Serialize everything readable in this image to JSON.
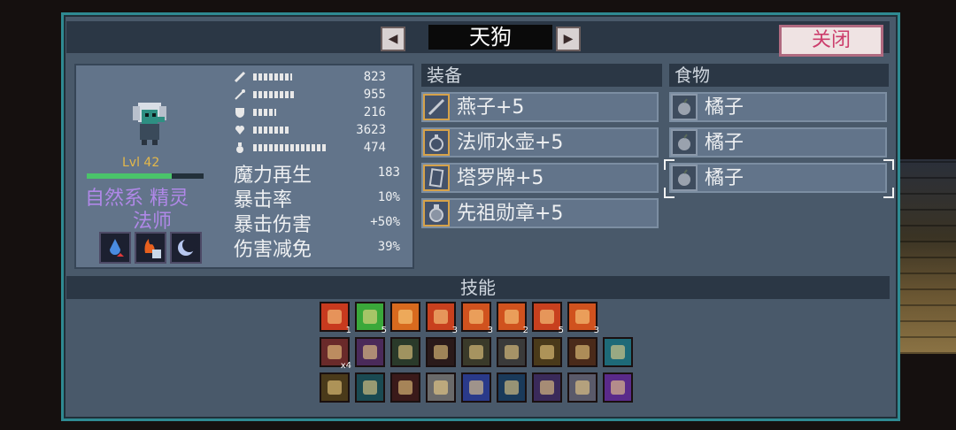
{
  "header": {
    "title": "天狗",
    "close_label": "关闭",
    "prev_icon": "triangle-left",
    "next_icon": "triangle-right"
  },
  "character": {
    "level": "Lvl 42",
    "class_line1": "自然系 精灵",
    "class_line2": "法师",
    "hp_fraction": 0.73,
    "stats": [
      {
        "icon": "sword-icon",
        "value": "823"
      },
      {
        "icon": "wand-icon",
        "value": "955"
      },
      {
        "icon": "shield-icon",
        "value": "216"
      },
      {
        "icon": "heart-icon",
        "value": "3623"
      },
      {
        "icon": "potion-icon",
        "value": "474"
      }
    ],
    "extra_stats": [
      {
        "label": "魔力再生",
        "value": "183"
      },
      {
        "label": "暴击率",
        "value": "10%"
      },
      {
        "label": "暴击伤害",
        "value": "+50%"
      },
      {
        "label": "伤害减免",
        "value": "39%"
      }
    ],
    "traits": [
      "water-drop-icon",
      "fire-shield-icon",
      "moon-icon"
    ]
  },
  "equipment": {
    "header": "装备",
    "items": [
      {
        "label": "燕子+5",
        "icon": "staff-icon"
      },
      {
        "label": "法师水壶+5",
        "icon": "flask-icon"
      },
      {
        "label": "塔罗牌+5",
        "icon": "card-icon"
      },
      {
        "label": "先祖勋章+5",
        "icon": "medal-icon"
      }
    ]
  },
  "food": {
    "header": "食物",
    "items": [
      {
        "label": "橘子",
        "icon": "orange-icon"
      },
      {
        "label": "橘子",
        "icon": "orange-icon"
      },
      {
        "label": "橘子",
        "icon": "orange-icon"
      }
    ]
  },
  "skills": {
    "header": "技能",
    "row1": [
      {
        "icon": "fire-burst-icon",
        "count": "1",
        "color": "#c83a1e"
      },
      {
        "icon": "green-burst-icon",
        "count": "5",
        "color": "#3aa83a"
      },
      {
        "icon": "flame-pillar-icon",
        "count": "",
        "color": "#d86a1e"
      },
      {
        "icon": "fire-wave-icon",
        "count": "3",
        "color": "#c8401e"
      },
      {
        "icon": "fire-bolt-icon",
        "count": "3",
        "color": "#d0521e"
      },
      {
        "icon": "fire-bolt-icon",
        "count": "2",
        "color": "#d0521e"
      },
      {
        "icon": "fire-blast-icon",
        "count": "5",
        "color": "#c8401e"
      },
      {
        "icon": "fire-rain-icon",
        "count": "3",
        "color": "#d0521e"
      }
    ],
    "row2": [
      {
        "icon": "red-demon-icon",
        "count": "x4",
        "color": "#6a2a2a"
      },
      {
        "icon": "purple-heart-icon",
        "count": "",
        "color": "#4a2a5a"
      },
      {
        "icon": "dark-blade-icon",
        "count": "",
        "color": "#2a3a2a"
      },
      {
        "icon": "shadow-icon",
        "count": "",
        "color": "#2a1a1a"
      },
      {
        "icon": "arrow-icon",
        "count": "",
        "color": "#3a3a2a"
      },
      {
        "icon": "crossed-swords-icon",
        "count": "",
        "color": "#3a3a3a"
      },
      {
        "icon": "slash-icon",
        "count": "",
        "color": "#4a3a1a"
      },
      {
        "icon": "fire-lock-icon",
        "count": "",
        "color": "#4a2a1a"
      },
      {
        "icon": "cyan-shield-icon",
        "count": "",
        "color": "#1e6a78"
      }
    ],
    "row3": [
      {
        "icon": "rising-arrow-icon",
        "count": "",
        "color": "#4a3a1a"
      },
      {
        "icon": "cyan-scythe-icon",
        "count": "",
        "color": "#1a4a52"
      },
      {
        "icon": "downward-fire-icon",
        "count": "",
        "color": "#3a1a1a"
      },
      {
        "icon": "stone-icon",
        "count": "",
        "color": "#6a6a6a"
      },
      {
        "icon": "crown-icon",
        "count": "",
        "color": "#2a3a8a"
      },
      {
        "icon": "mask-icon",
        "count": "",
        "color": "#1a3a5a"
      },
      {
        "icon": "purple-scythe-icon",
        "count": "",
        "color": "#3a2a5a"
      },
      {
        "icon": "scroll-icon",
        "count": "",
        "color": "#5a5a6a"
      },
      {
        "icon": "purple-rune-icon",
        "count": "",
        "color": "#5a2a8a"
      }
    ]
  },
  "colors": {
    "panel": "#49596a",
    "border": "#2f8a92",
    "class_text": "#b088e8",
    "level_text": "#e4b84a",
    "close_text": "#cc3d6c"
  }
}
